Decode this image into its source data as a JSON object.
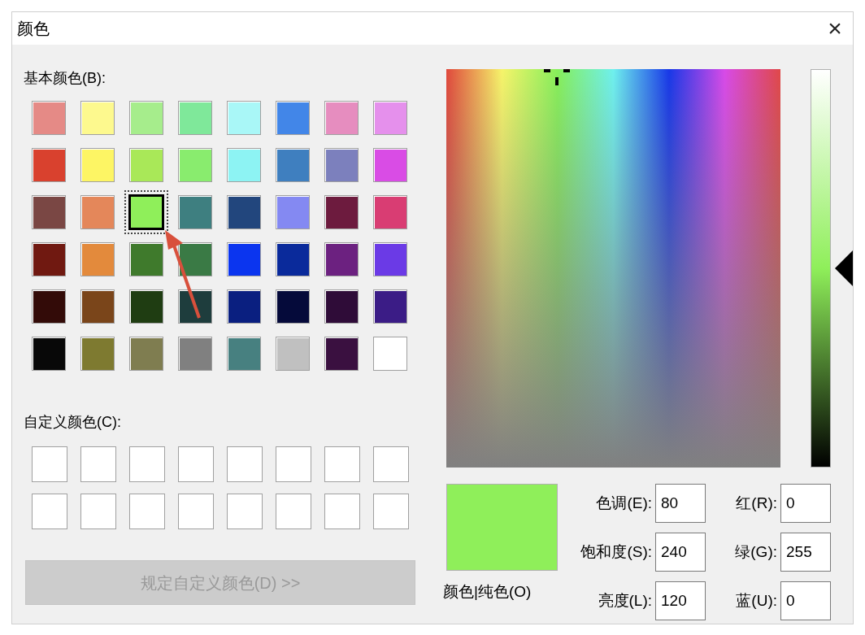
{
  "window": {
    "title": "颜色",
    "close": "×"
  },
  "basic_colors": {
    "label": "基本颜色(B):",
    "swatches": [
      {
        "color": "#e58a86",
        "selected": false
      },
      {
        "color": "#fdf98e",
        "selected": false
      },
      {
        "color": "#a6ed8c",
        "selected": false
      },
      {
        "color": "#7fe89a",
        "selected": false
      },
      {
        "color": "#a9f7f7",
        "selected": false
      },
      {
        "color": "#4286e8",
        "selected": false
      },
      {
        "color": "#e68dbf",
        "selected": false
      },
      {
        "color": "#e590ec",
        "selected": false
      },
      {
        "color": "#d9412e",
        "selected": false
      },
      {
        "color": "#fdf564",
        "selected": false
      },
      {
        "color": "#a9e858",
        "selected": false
      },
      {
        "color": "#89ec6e",
        "selected": false
      },
      {
        "color": "#8df3f3",
        "selected": false
      },
      {
        "color": "#3f7fbf",
        "selected": false
      },
      {
        "color": "#7c80bd",
        "selected": false
      },
      {
        "color": "#d94ce5",
        "selected": false
      },
      {
        "color": "#7a4744",
        "selected": false
      },
      {
        "color": "#e4875a",
        "selected": false
      },
      {
        "color": "#8fef5a",
        "selected": true
      },
      {
        "color": "#3e7f80",
        "selected": false
      },
      {
        "color": "#22467d",
        "selected": false
      },
      {
        "color": "#8489f2",
        "selected": false
      },
      {
        "color": "#6d1b3e",
        "selected": false
      },
      {
        "color": "#d93d73",
        "selected": false
      },
      {
        "color": "#701911",
        "selected": false
      },
      {
        "color": "#e38a3c",
        "selected": false
      },
      {
        "color": "#3f7a2c",
        "selected": false
      },
      {
        "color": "#3a7a45",
        "selected": false
      },
      {
        "color": "#0b35ef",
        "selected": false
      },
      {
        "color": "#0a2a9b",
        "selected": false
      },
      {
        "color": "#6c2180",
        "selected": false
      },
      {
        "color": "#6b3ae6",
        "selected": false
      },
      {
        "color": "#330b08",
        "selected": false
      },
      {
        "color": "#7a451a",
        "selected": false
      },
      {
        "color": "#1f3d12",
        "selected": false
      },
      {
        "color": "#1e3d3d",
        "selected": false
      },
      {
        "color": "#0a1f80",
        "selected": false
      },
      {
        "color": "#050a3a",
        "selected": false
      },
      {
        "color": "#2f0c38",
        "selected": false
      },
      {
        "color": "#3b1c86",
        "selected": false
      },
      {
        "color": "#080808",
        "selected": false
      },
      {
        "color": "#7e7a30",
        "selected": false
      },
      {
        "color": "#7f7d50",
        "selected": false
      },
      {
        "color": "#808080",
        "selected": false
      },
      {
        "color": "#478080",
        "selected": false
      },
      {
        "color": "#c0c0c0",
        "selected": false
      },
      {
        "color": "#3a1040",
        "selected": false
      },
      {
        "color": "#ffffff",
        "selected": false
      }
    ]
  },
  "custom_colors": {
    "label": "自定义颜色(C):",
    "swatches": [
      {
        "color": "#ffffff"
      },
      {
        "color": "#ffffff"
      },
      {
        "color": "#ffffff"
      },
      {
        "color": "#ffffff"
      },
      {
        "color": "#ffffff"
      },
      {
        "color": "#ffffff"
      },
      {
        "color": "#ffffff"
      },
      {
        "color": "#ffffff"
      },
      {
        "color": "#ffffff"
      },
      {
        "color": "#ffffff"
      },
      {
        "color": "#ffffff"
      },
      {
        "color": "#ffffff"
      },
      {
        "color": "#ffffff"
      },
      {
        "color": "#ffffff"
      },
      {
        "color": "#ffffff"
      },
      {
        "color": "#ffffff"
      }
    ]
  },
  "define_button": {
    "label": "规定自定义颜色(D) >>",
    "disabled": true
  },
  "luminance_slider": {
    "level": 0.5
  },
  "preview": {
    "color": "#8fef5a",
    "label": "颜色|纯色(O)"
  },
  "fields": [
    {
      "label": "色调(E):",
      "value": "80"
    },
    {
      "label": "红(R):",
      "value": "0"
    },
    {
      "label": "饱和度(S):",
      "value": "240"
    },
    {
      "label": "绿(G):",
      "value": "255"
    },
    {
      "label": "亮度(L):",
      "value": "120"
    },
    {
      "label": "蓝(U):",
      "value": "0"
    }
  ]
}
